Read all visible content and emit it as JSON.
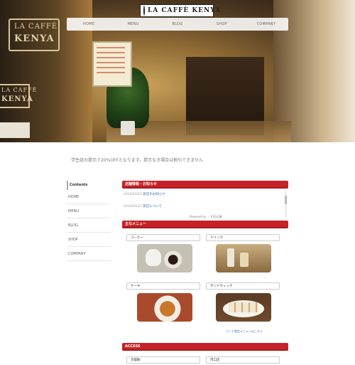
{
  "hero": {
    "sign_top": "LA CAFFÈ",
    "sign_bottom": "KENYA",
    "sign_mid_top": "LA CAFFÈ",
    "sign_mid_bottom": "KENYA"
  },
  "logo": {
    "text": "LA CAFFÈ KENYA"
  },
  "nav": {
    "items": [
      "HOME",
      "MENU",
      "BLOG",
      "SHOP",
      "COMPANY"
    ]
  },
  "notice": "学生証の提示で20%OFFとなります。提示なき場合は割引できません",
  "sidebar": {
    "heading": "Contents",
    "items": [
      "HOME",
      "MENU",
      "BLOG",
      "SHOP",
      "COMPANY"
    ]
  },
  "news": {
    "title": "店舗情報・お知らせ",
    "rows": [
      {
        "date": "2014/03/22",
        "text": "新店のお知らせ"
      },
      {
        "date": "2014/03/22",
        "text": "新店について"
      }
    ],
    "powered": "Powered by ・ RSS記事"
  },
  "menu": {
    "title": "主なメニュー",
    "items": [
      "コーヒー",
      "ドリンク",
      "ケーキ",
      "サンドウィッチ"
    ],
    "more": "フード限定メニューはこちら"
  },
  "access": {
    "title": "ACCESS",
    "items": [
      "京都駅",
      "市口店"
    ]
  }
}
